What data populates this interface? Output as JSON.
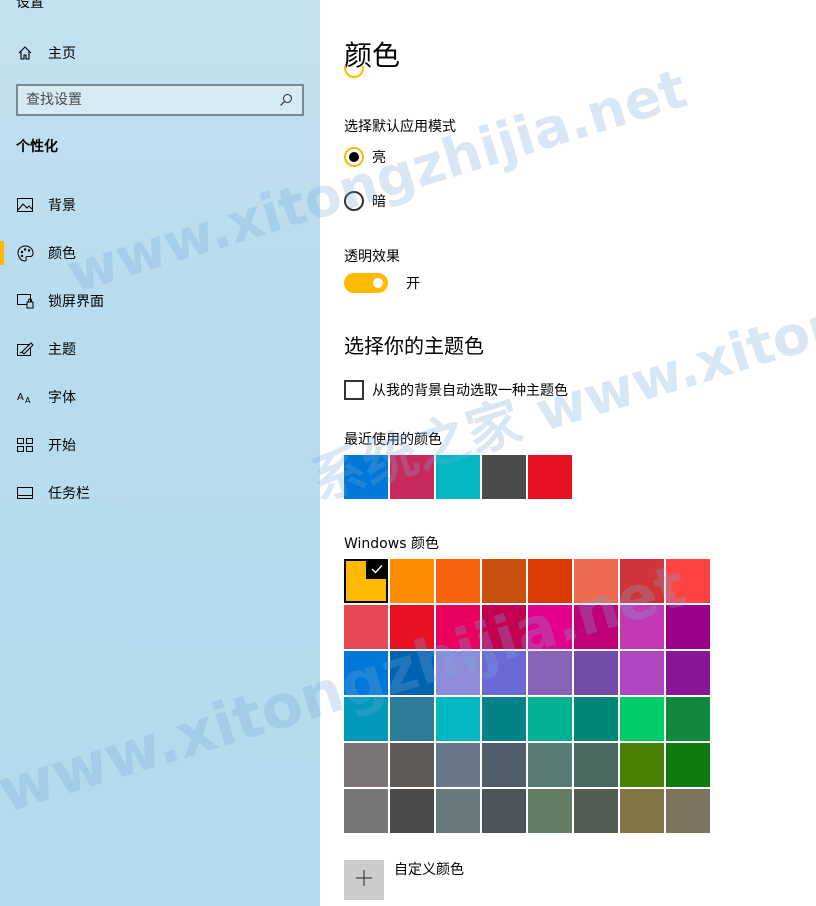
{
  "sidebar": {
    "top_cut": "设置",
    "home_label": "主页",
    "search": {
      "placeholder": "查找设置"
    },
    "section_title": "个性化",
    "items": [
      {
        "label": "背景",
        "icon": "picture-icon"
      },
      {
        "label": "颜色",
        "icon": "palette-icon",
        "active": true
      },
      {
        "label": "锁屏界面",
        "icon": "lock-screen-icon"
      },
      {
        "label": "主题",
        "icon": "theme-brush-icon"
      },
      {
        "label": "字体",
        "icon": "font-icon"
      },
      {
        "label": "开始",
        "icon": "start-grid-icon"
      },
      {
        "label": "任务栏",
        "icon": "taskbar-icon"
      }
    ]
  },
  "main": {
    "title": "颜色",
    "default_mode_label": "选择默认应用模式",
    "mode_options": [
      {
        "label": "亮",
        "checked": true
      },
      {
        "label": "暗",
        "checked": false
      }
    ],
    "transparency_label": "透明效果",
    "transparency_state": "开",
    "accent_title": "选择你的主题色",
    "auto_pick_label": "从我的背景自动选取一种主题色",
    "recent_label": "最近使用的颜色",
    "recent_colors": [
      "#0078d7",
      "#c92a5d",
      "#00b7c3",
      "#4c4a48",
      "#e81123"
    ],
    "windows_colors_label": "Windows 颜色",
    "windows_colors": [
      "#ffb900",
      "#ff8c00",
      "#f7630c",
      "#ca5010",
      "#da3b01",
      "#ef6950",
      "#d13438",
      "#ff4343",
      "#e74856",
      "#e81123",
      "#ea005e",
      "#c30052",
      "#e3008c",
      "#bf0077",
      "#c239b3",
      "#9a0089",
      "#0078d7",
      "#0063b1",
      "#8e8cd8",
      "#6b69d6",
      "#8764b8",
      "#744da9",
      "#b146c2",
      "#881798",
      "#0099bc",
      "#2d7d9a",
      "#00b7c3",
      "#038387",
      "#00b294",
      "#018574",
      "#00cc6a",
      "#10893e",
      "#7a7574",
      "#5d5a58",
      "#68768a",
      "#515c6b",
      "#567c73",
      "#486860",
      "#498205",
      "#107c10",
      "#767676",
      "#4c4a48",
      "#69797e",
      "#4a5459",
      "#647c64",
      "#525e54",
      "#847545",
      "#7e735f"
    ],
    "selected_color": "#ffb900",
    "custom_color_label": "自定义颜色"
  },
  "watermark": {
    "line1": "www.xitongzhijia.net",
    "line2": "系统之家 www.xitongzhijia.net"
  }
}
